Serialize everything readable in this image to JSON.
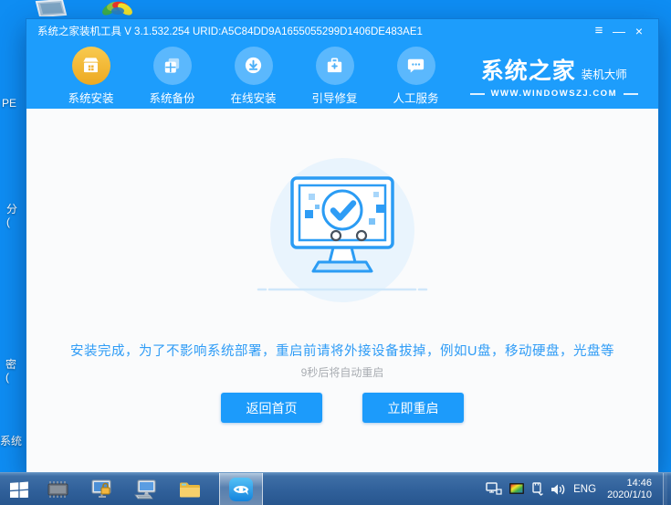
{
  "window": {
    "title": "系统之家装机工具 V 3.1.532.254 URID:A5C84DD9A1655055299D1406DE483AE1",
    "controls": {
      "menu": "≡",
      "minimize": "—",
      "close": "×"
    }
  },
  "nav": {
    "items": [
      {
        "label": "系统安装",
        "icon": "system-install-icon",
        "active": true
      },
      {
        "label": "系统备份",
        "icon": "system-backup-icon",
        "active": false
      },
      {
        "label": "在线安装",
        "icon": "online-install-icon",
        "active": false
      },
      {
        "label": "引导修复",
        "icon": "boot-repair-icon",
        "active": false
      },
      {
        "label": "人工服务",
        "icon": "support-service-icon",
        "active": false
      }
    ],
    "logo": {
      "brand": "系统之家",
      "tagline": "装机大师",
      "site": "WWW.WINDOWSZJ.COM"
    }
  },
  "main": {
    "message": "安装完成，为了不影响系统部署，重启前请将外接设备拔掉，例如U盘，移动硬盘，光盘等",
    "countdown": "9秒后将自动重启",
    "home_button": "返回首页",
    "restart_button": "立即重启"
  },
  "taskbar": {
    "language": "ENG",
    "time": "14:46",
    "date": "2020/1/10"
  },
  "desktop": {
    "fragment_pe": "PE",
    "fragment_fen": "分(",
    "fragment_mi": "密(",
    "fragment_xitong": "系统"
  },
  "colors": {
    "desktop_blue": "#0e8df3",
    "header_blue": "#1d9dfc",
    "active_gold": "#f2b531",
    "message_blue": "#2f9cf6",
    "button_blue": "#1c9bfb",
    "taskbar_blue": "#30609a"
  }
}
